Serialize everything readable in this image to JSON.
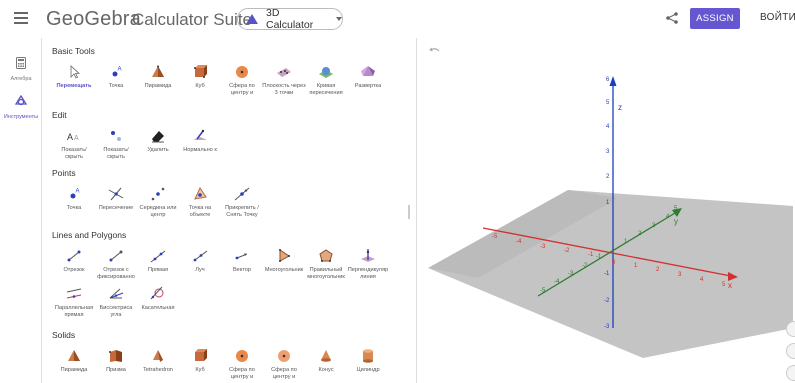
{
  "header": {
    "brand": "GeoGebra",
    "subtitle": "Calculator Suite",
    "app_selector": "3D Calculator",
    "assign_label": "ASSIGN",
    "login_label": "ВОЙТИ..."
  },
  "sidebar": {
    "items": [
      {
        "label": "Алгебра"
      },
      {
        "label": "Инструменты"
      }
    ]
  },
  "tools": {
    "sections": [
      {
        "title": "Basic Tools",
        "items": [
          "Перемещать",
          "Точка",
          "Пирамида",
          "Куб",
          "Сфера по центру и",
          "Плоскость через 3 точки",
          "Кривая пересечения",
          "Развертка"
        ]
      },
      {
        "title": "Edit",
        "items": [
          "Показать/ скрыть",
          "Показать/ скрыть",
          "Удалить",
          "Нормально к"
        ]
      },
      {
        "title": "Points",
        "items": [
          "Точка",
          "Пересечение",
          "Середина или центр",
          "Точка на объекте",
          "Прикрепить / Снять Точку"
        ]
      },
      {
        "title": "Lines and Polygons",
        "items": [
          "Отрезок",
          "Отрезок с фиксированно",
          "Прямая",
          "Луч",
          "Вектор",
          "Многоугольник",
          "Правильный многоугольник",
          "Перпендикуляр линия",
          "Параллельная прямая",
          "Биссектриса угла",
          "Касательная"
        ]
      },
      {
        "title": "Solids",
        "items": [
          "Пирамида",
          "Призма",
          "Tetrahedron",
          "Куб",
          "Сфера по центру и",
          "Сфера по центру и",
          "Конус",
          "Цилиндр"
        ]
      }
    ]
  },
  "view3d": {
    "axes": {
      "x_label": "x",
      "y_label": "y",
      "z_label": "z",
      "x_ticks": [
        "-5",
        "-4",
        "-3",
        "-2",
        "-1",
        "0",
        "1",
        "2",
        "3",
        "4",
        "5"
      ],
      "y_ticks": [
        "-5",
        "-4",
        "-3",
        "-2",
        "-1",
        "1",
        "2",
        "3",
        "4",
        "5"
      ],
      "z_ticks": [
        "-3",
        "-2",
        "-1",
        "1",
        "2",
        "3",
        "4",
        "5",
        "6"
      ]
    },
    "colors": {
      "x_axis": "#d32f2f",
      "y_axis": "#2e7d32",
      "z_axis": "#1a3fbf",
      "plane": "#bdbdbd"
    }
  },
  "colors": {
    "accent": "#6557d2"
  }
}
